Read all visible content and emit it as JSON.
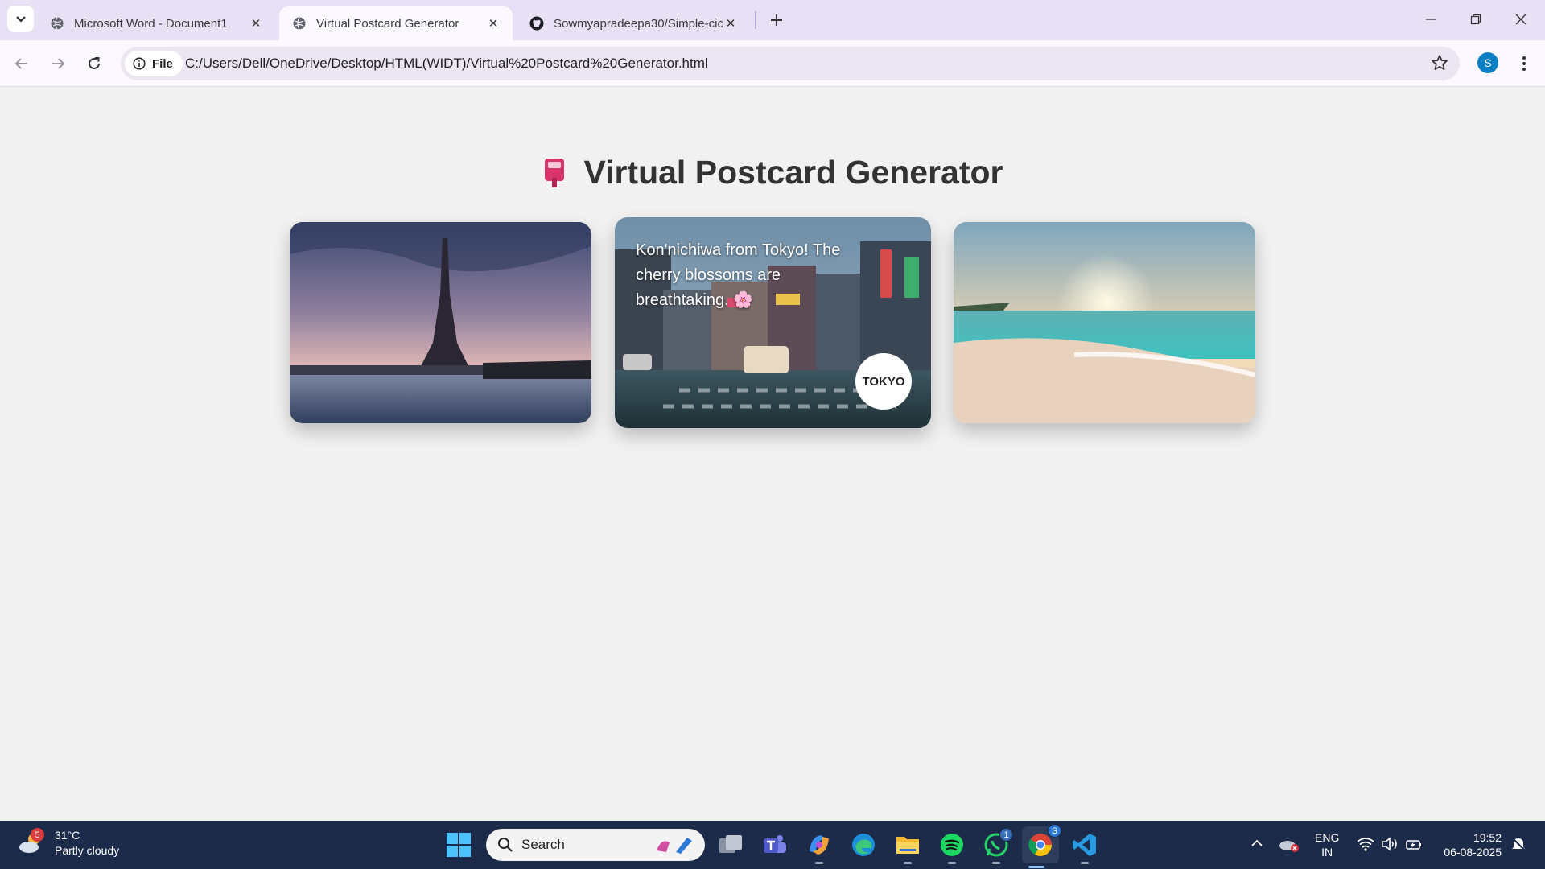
{
  "browser": {
    "tabs": [
      {
        "title": "Microsoft Word - Document1",
        "active": false,
        "icon": "globe-icon"
      },
      {
        "title": "Virtual Postcard Generator",
        "active": true,
        "icon": "globe-icon"
      },
      {
        "title": "Sowmyapradeepa30/Simple-cic",
        "active": false,
        "icon": "github-icon"
      }
    ],
    "chip_label": "File",
    "url": "C:/Users/Dell/OneDrive/Desktop/HTML(WIDT)/Virtual%20Postcard%20Generator.html",
    "profile_initial": "S"
  },
  "page": {
    "emoji": "📮",
    "title": "Virtual Postcard Generator",
    "cards": [
      {
        "name": "paris",
        "photo": "eiffel-tower-river-photo"
      },
      {
        "name": "tokyo",
        "photo": "tokyo-street-photo",
        "message": "Kon'nichiwa from Tokyo! The cherry blossoms are breathtaking. 🌸",
        "stamp": "TOKYO"
      },
      {
        "name": "beach",
        "photo": "tropical-beach-sunset-photo"
      }
    ]
  },
  "taskbar": {
    "weather": {
      "badge": "5",
      "temp": "31°C",
      "condition": "Partly cloudy"
    },
    "search_placeholder": "Search",
    "whatsapp_badge": "1",
    "chrome_badge": "S",
    "lang_line1": "ENG",
    "lang_line2": "IN",
    "time": "19:52",
    "date": "06-08-2025"
  }
}
